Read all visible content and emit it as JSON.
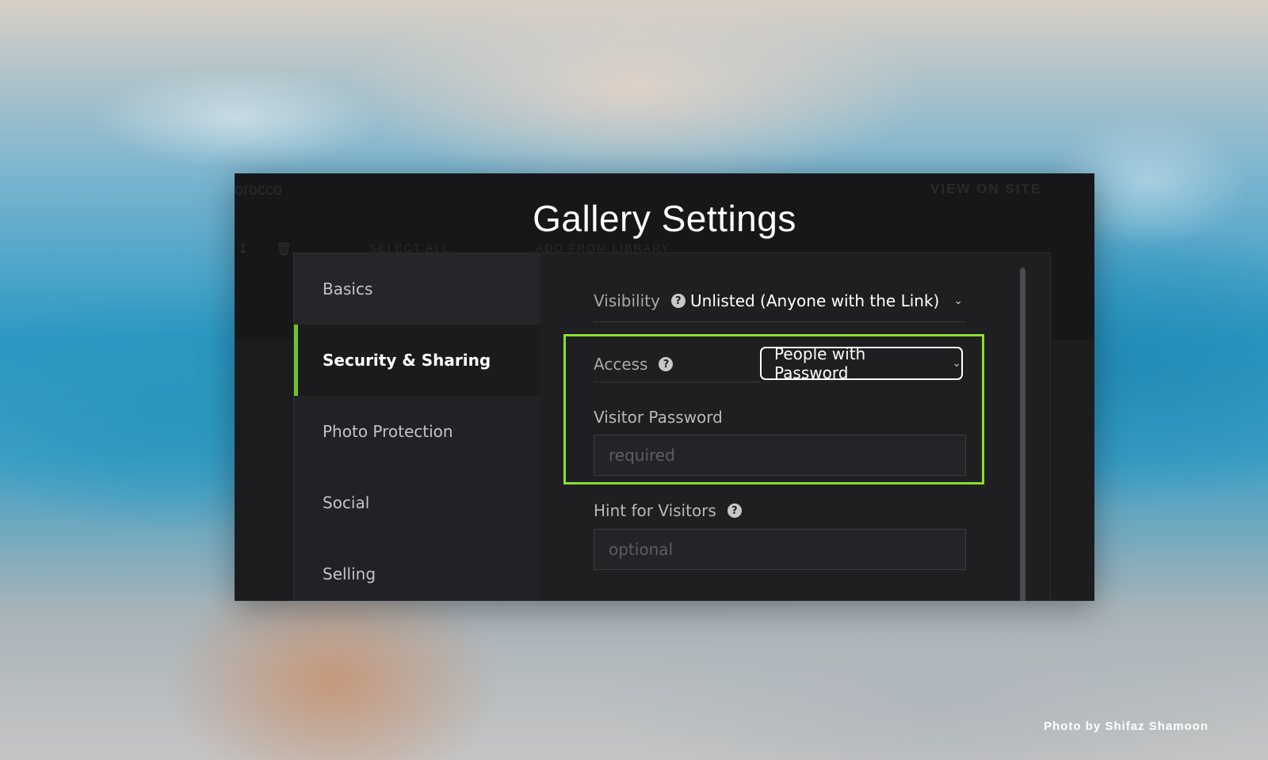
{
  "background": {
    "credit": "Photo by Shifaz Shamoon"
  },
  "backdrop_app": {
    "gallery_name": "orocco",
    "view_on_site": "VIEW ON SITE",
    "select_all": "SELECT ALL",
    "add_from_library": "ADD FROM LIBRARY"
  },
  "modal": {
    "title": "Gallery Settings",
    "nav": [
      {
        "label": "Basics",
        "active": false
      },
      {
        "label": "Security & Sharing",
        "active": true
      },
      {
        "label": "Photo Protection",
        "active": false
      },
      {
        "label": "Social",
        "active": false
      },
      {
        "label": "Selling",
        "active": false
      }
    ],
    "visibility": {
      "label": "Visibility",
      "value": "Unlisted (Anyone with the Link)",
      "help_icon": "question-icon"
    },
    "access": {
      "label": "Access",
      "value": "People with Password",
      "help_icon": "question-icon"
    },
    "visitor_password": {
      "label": "Visitor Password",
      "placeholder": "required",
      "value": ""
    },
    "hint": {
      "label": "Hint for Visitors",
      "placeholder": "optional",
      "value": "",
      "help_icon": "question-icon"
    }
  },
  "colors": {
    "accent_green": "#6cc42c",
    "highlight_green": "#8be028",
    "modal_bg": "#17171a"
  }
}
